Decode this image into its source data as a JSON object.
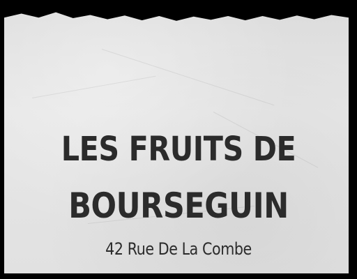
{
  "receipt": {
    "title_line_1": "LES FRUITS DE",
    "title_line_2": "BOURSEGUIN",
    "address": "42 Rue De La Combe"
  }
}
